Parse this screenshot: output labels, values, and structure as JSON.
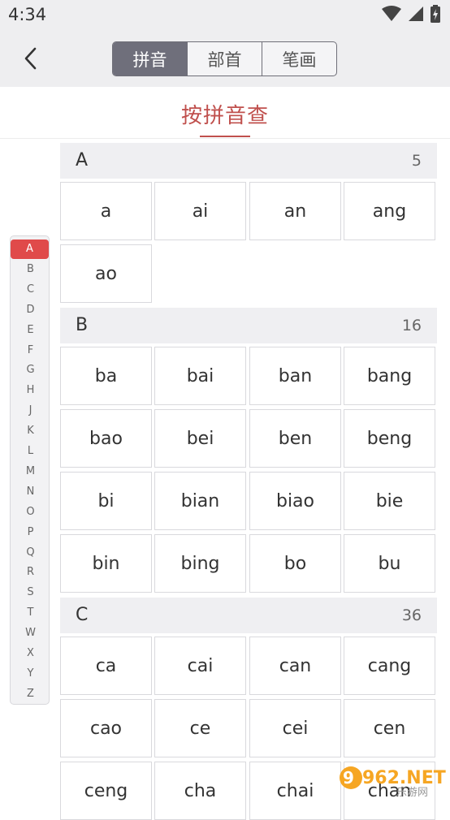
{
  "status_bar": {
    "time": "4:34"
  },
  "header": {
    "tabs": [
      {
        "label": "拼音",
        "active": true
      },
      {
        "label": "部首",
        "active": false
      },
      {
        "label": "笔画",
        "active": false
      }
    ]
  },
  "page_title": "按拼音查",
  "index_letters": [
    "A",
    "B",
    "C",
    "D",
    "E",
    "F",
    "G",
    "H",
    "J",
    "K",
    "L",
    "M",
    "N",
    "O",
    "P",
    "Q",
    "R",
    "S",
    "T",
    "W",
    "X",
    "Y",
    "Z"
  ],
  "active_index": "A",
  "sections": [
    {
      "letter": "A",
      "count": "5",
      "items": [
        "a",
        "ai",
        "an",
        "ang",
        "ao"
      ]
    },
    {
      "letter": "B",
      "count": "16",
      "items": [
        "ba",
        "bai",
        "ban",
        "bang",
        "bao",
        "bei",
        "ben",
        "beng",
        "bi",
        "bian",
        "biao",
        "bie",
        "bin",
        "bing",
        "bo",
        "bu"
      ]
    },
    {
      "letter": "C",
      "count": "36",
      "items": [
        "ca",
        "cai",
        "can",
        "cang",
        "cao",
        "ce",
        "cei",
        "cen",
        "ceng",
        "cha",
        "chai",
        "chan"
      ]
    }
  ],
  "watermark": {
    "text": "962.NET",
    "subtext": "乐游网"
  },
  "colors": {
    "accent": "#c0504d",
    "active_tab": "#6f6f7b",
    "index_active": "#e04a4a"
  }
}
